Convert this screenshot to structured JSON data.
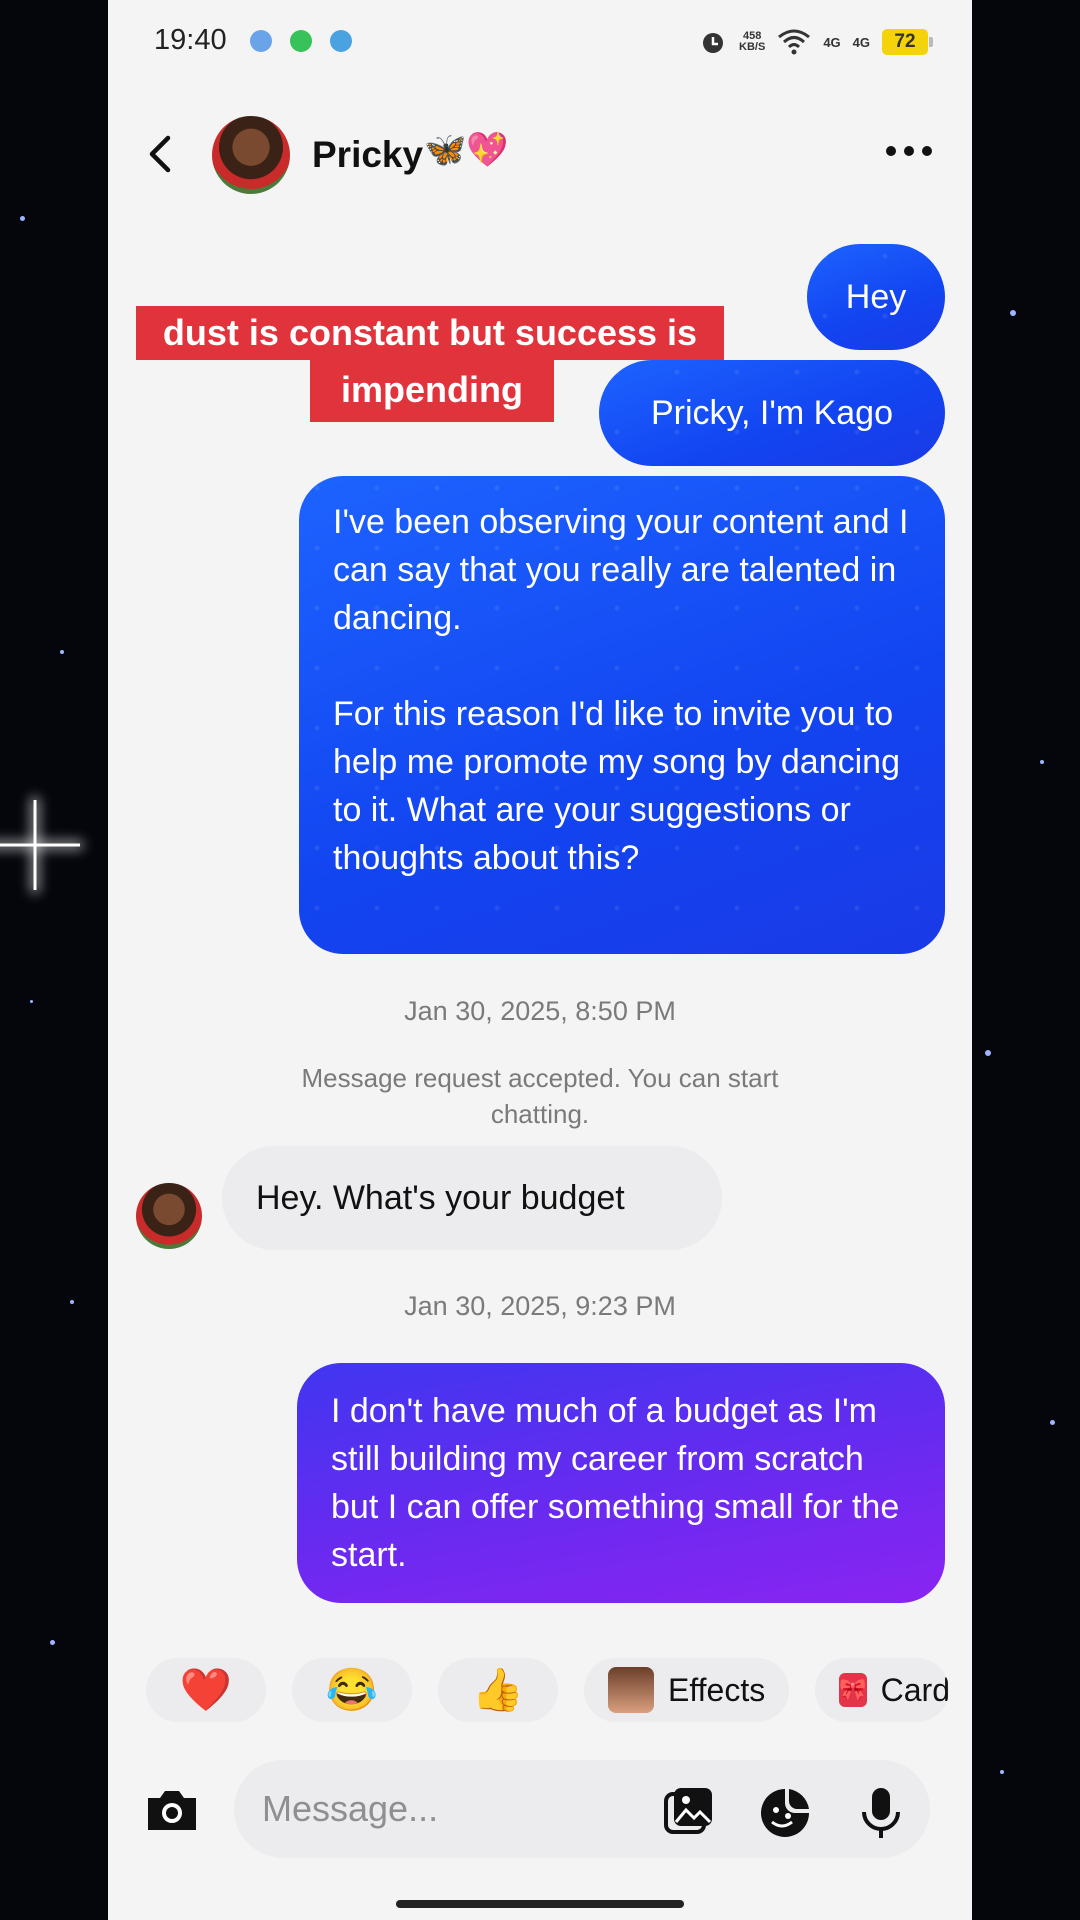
{
  "status_bar": {
    "time": "19:40",
    "net_speed_value": "458",
    "net_speed_unit": "KB/S",
    "sig1": "4G",
    "sig2": "4G",
    "battery": "72"
  },
  "header": {
    "contact_name": "Pricky",
    "name_emoji": "🦋💖"
  },
  "caption": {
    "line1": "dust is constant but success is",
    "line2": "impending"
  },
  "messages": {
    "m1": "Hey",
    "m2": "Pricky, I'm Kago",
    "m3_p1": "I've been observing your content and I can say that you really are talented in dancing.",
    "m3_p2": "For this reason I'd like to invite you to help me promote my song by dancing to it. What are your suggestions or thoughts about this?",
    "ts1": "Jan 30, 2025, 8:50 PM",
    "system": "Message request accepted. You can start chatting.",
    "m4": "Hey. What's your budget",
    "ts2": "Jan 30, 2025, 9:23 PM",
    "m5": "I don't have much of a budget as I'm still building my career from scratch but I can offer something small for the start."
  },
  "reactions": {
    "heart": "❤️",
    "laugh": "😂",
    "thumbs": "👍",
    "effects_label": "Effects",
    "cards_label": "Card"
  },
  "composer": {
    "placeholder": "Message..."
  }
}
